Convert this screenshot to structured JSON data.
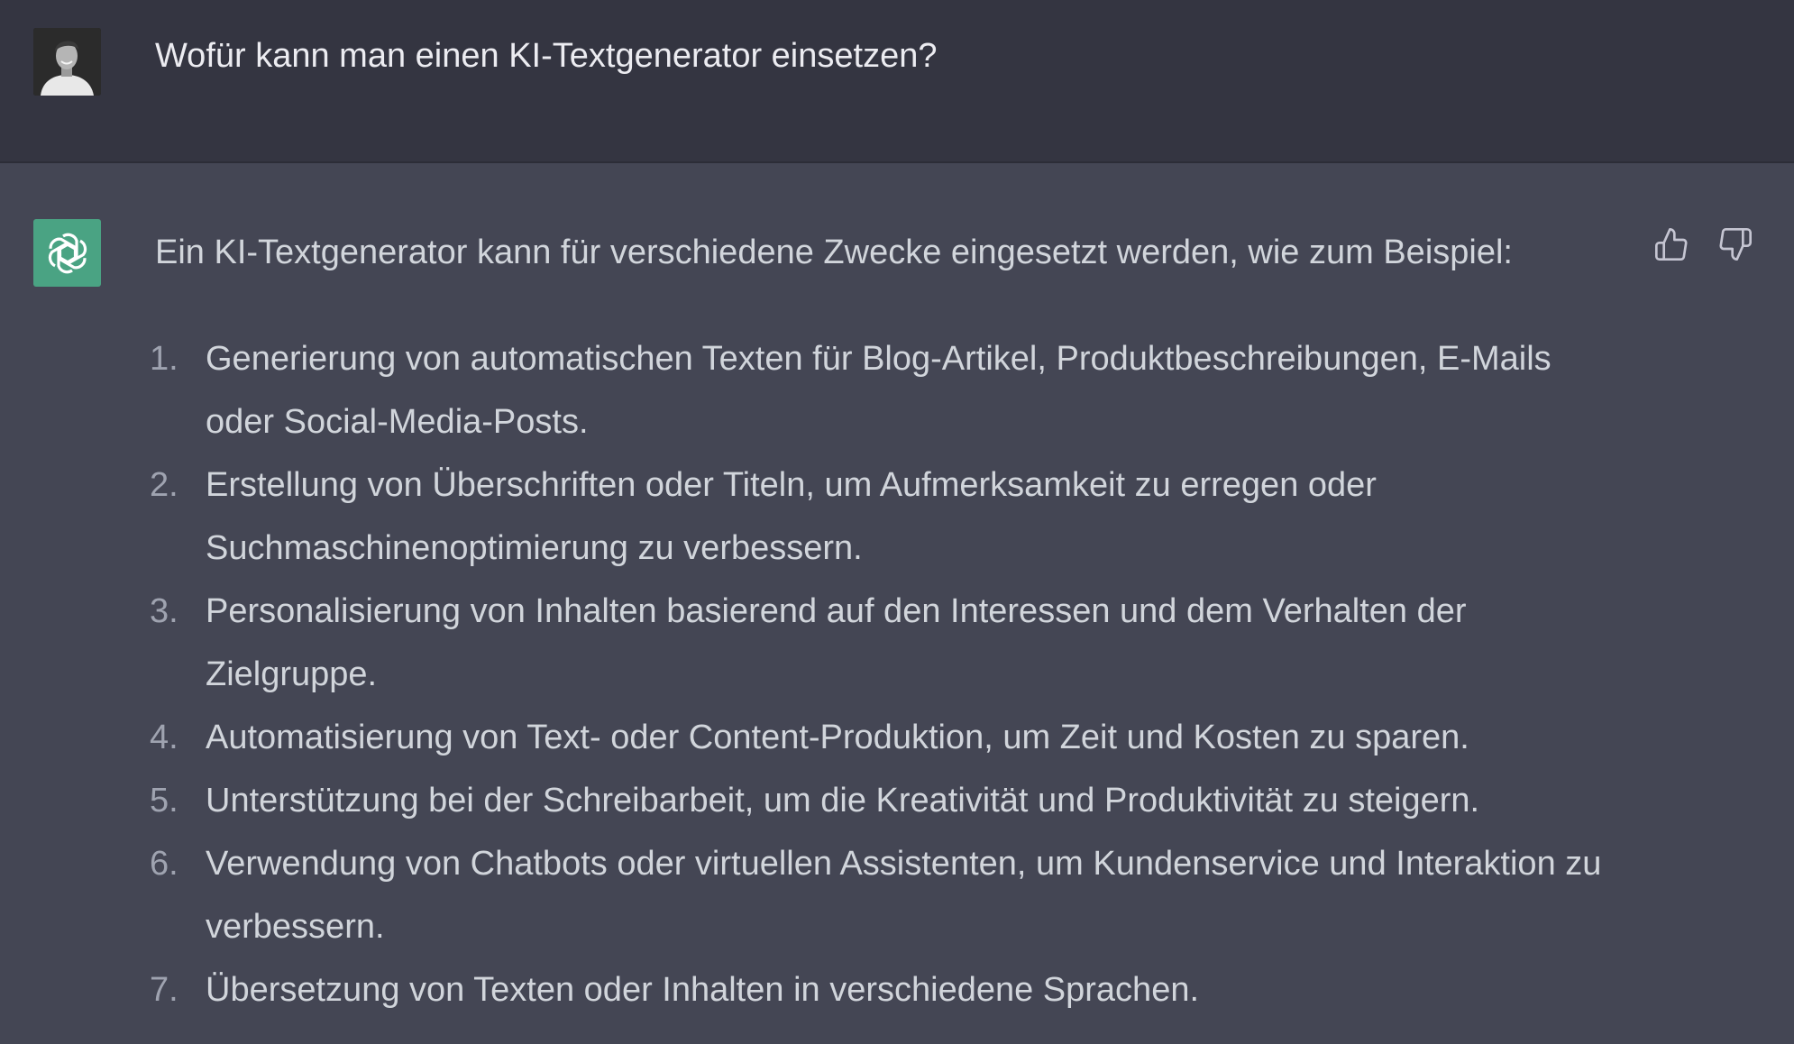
{
  "user_message": {
    "text": "Wofür kann man einen KI-Textgenerator einsetzen?",
    "avatar_icon": "user-photo-avatar"
  },
  "assistant_message": {
    "avatar_icon": "openai-logo-icon",
    "avatar_color": "#4aa383",
    "intro": "Ein KI-Textgenerator kann für verschiedene Zwecke eingesetzt werden, wie zum Beispiel:",
    "items": [
      {
        "number": "1.",
        "text": "Generierung von automatischen Texten für Blog-Artikel, Produktbeschreibungen, E-Mails oder Social-Media-Posts."
      },
      {
        "number": "2.",
        "text": "Erstellung von Überschriften oder Titeln, um Aufmerksamkeit zu erregen oder Suchmaschinenoptimierung zu verbessern."
      },
      {
        "number": "3.",
        "text": "Personalisierung von Inhalten basierend auf den Interessen und dem Verhalten der Zielgruppe."
      },
      {
        "number": "4.",
        "text": "Automatisierung von Text- oder Content-Produktion, um Zeit und Kosten zu sparen."
      },
      {
        "number": "5.",
        "text": "Unterstützung bei der Schreibarbeit, um die Kreativität und Produktivität zu steigern."
      },
      {
        "number": "6.",
        "text": "Verwendung von Chatbots oder virtuellen Assistenten, um Kundenservice und Interaktion zu verbessern."
      },
      {
        "number": "7.",
        "text": "Übersetzung von Texten oder Inhalten in verschiedene Sprachen."
      }
    ],
    "feedback": {
      "thumbs_up_icon": "thumbs-up-icon",
      "thumbs_down_icon": "thumbs-down-icon"
    }
  },
  "colors": {
    "user_bg": "#343541",
    "assistant_bg": "#444654",
    "text": "#d1d5db"
  }
}
